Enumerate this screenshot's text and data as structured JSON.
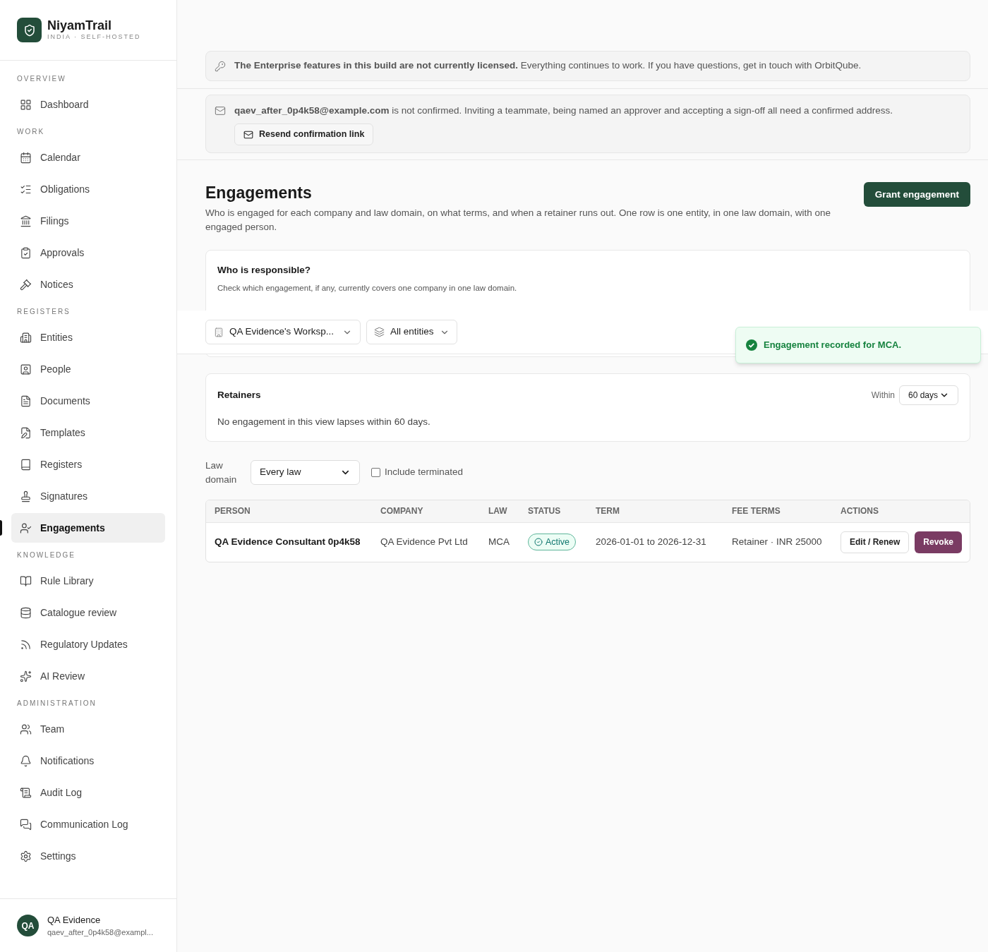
{
  "brand": {
    "name": "NiyamTrail",
    "subtitle": "INDIA · SELF-HOSTED"
  },
  "sidebar": {
    "sections": [
      {
        "title": "OVERVIEW",
        "items": [
          {
            "label": "Dashboard",
            "selected": false
          }
        ]
      },
      {
        "title": "WORK",
        "items": [
          {
            "label": "Calendar",
            "selected": false
          },
          {
            "label": "Obligations",
            "selected": false
          },
          {
            "label": "Filings",
            "selected": false
          },
          {
            "label": "Approvals",
            "selected": false
          },
          {
            "label": "Notices",
            "selected": false
          }
        ]
      },
      {
        "title": "REGISTERS",
        "items": [
          {
            "label": "Entities",
            "selected": false
          },
          {
            "label": "People",
            "selected": false
          },
          {
            "label": "Documents",
            "selected": false
          },
          {
            "label": "Templates",
            "selected": false
          },
          {
            "label": "Registers",
            "selected": false
          },
          {
            "label": "Signatures",
            "selected": false
          },
          {
            "label": "Engagements",
            "selected": true
          }
        ]
      },
      {
        "title": "KNOWLEDGE",
        "items": [
          {
            "label": "Rule Library",
            "selected": false
          },
          {
            "label": "Catalogue review",
            "selected": false
          },
          {
            "label": "Regulatory Updates",
            "selected": false
          },
          {
            "label": "AI Review",
            "selected": false
          }
        ]
      },
      {
        "title": "ADMINISTRATION",
        "items": [
          {
            "label": "Team",
            "selected": false
          },
          {
            "label": "Notifications",
            "selected": false
          },
          {
            "label": "Audit Log",
            "selected": false
          },
          {
            "label": "Communication Log",
            "selected": false
          },
          {
            "label": "Settings",
            "selected": false
          }
        ]
      }
    ]
  },
  "user": {
    "initials": "QA",
    "name": "QA Evidence",
    "email": "qaev_after_0p4k58@exampl..."
  },
  "license_banner": "**The Enterprise features in this build are not currently licensed.** Everything continues to work. If you have questions, get in touch with OrbitQube.",
  "email_banner": {
    "text": "**qaev_after_0p4k58@example.com** is not confirmed. Inviting a teammate, being named an approver and accepting a sign-off all need a confirmed address.",
    "button": "Resend confirmation link"
  },
  "page": {
    "title": "Engagements",
    "description": "Who is engaged for each company and law domain, on what terms, and when a retainer runs out. One row is one entity, in one law domain, with one engaged person.",
    "primary_button": "Grant engagement"
  },
  "responsible_card": {
    "title": "Who is responsible?",
    "hint": "Check which engagement, if any, currently covers one company in one law domain."
  },
  "filter_bar": {
    "workspace": "QA Evidence's Worksp...",
    "entities": "All entities"
  },
  "toast": {
    "text": "Engagement recorded for MCA."
  },
  "retainers": {
    "title": "Retainers",
    "within_label": "Within",
    "within_value": "60 days",
    "empty_text": "No engagement in this view lapses within 60 days."
  },
  "filters": {
    "law_label": "Law domain",
    "law_value": "Every law",
    "include_terminated": {
      "label": "Include terminated",
      "checked": false
    }
  },
  "table": {
    "columns": [
      "PERSON",
      "COMPANY",
      "LAW",
      "STATUS",
      "TERM",
      "FEE TERMS",
      "ACTIONS"
    ],
    "rows": [
      {
        "person": "QA Evidence Consultant 0p4k58",
        "company": "QA Evidence Pvt Ltd",
        "law": "MCA",
        "status": {
          "label": "Active",
          "kind": "active"
        },
        "term": "2026-01-01 to 2026-12-31",
        "fee_terms": "Retainer · INR 25000",
        "actions": [
          "Edit / Renew",
          "Revoke"
        ]
      }
    ]
  }
}
